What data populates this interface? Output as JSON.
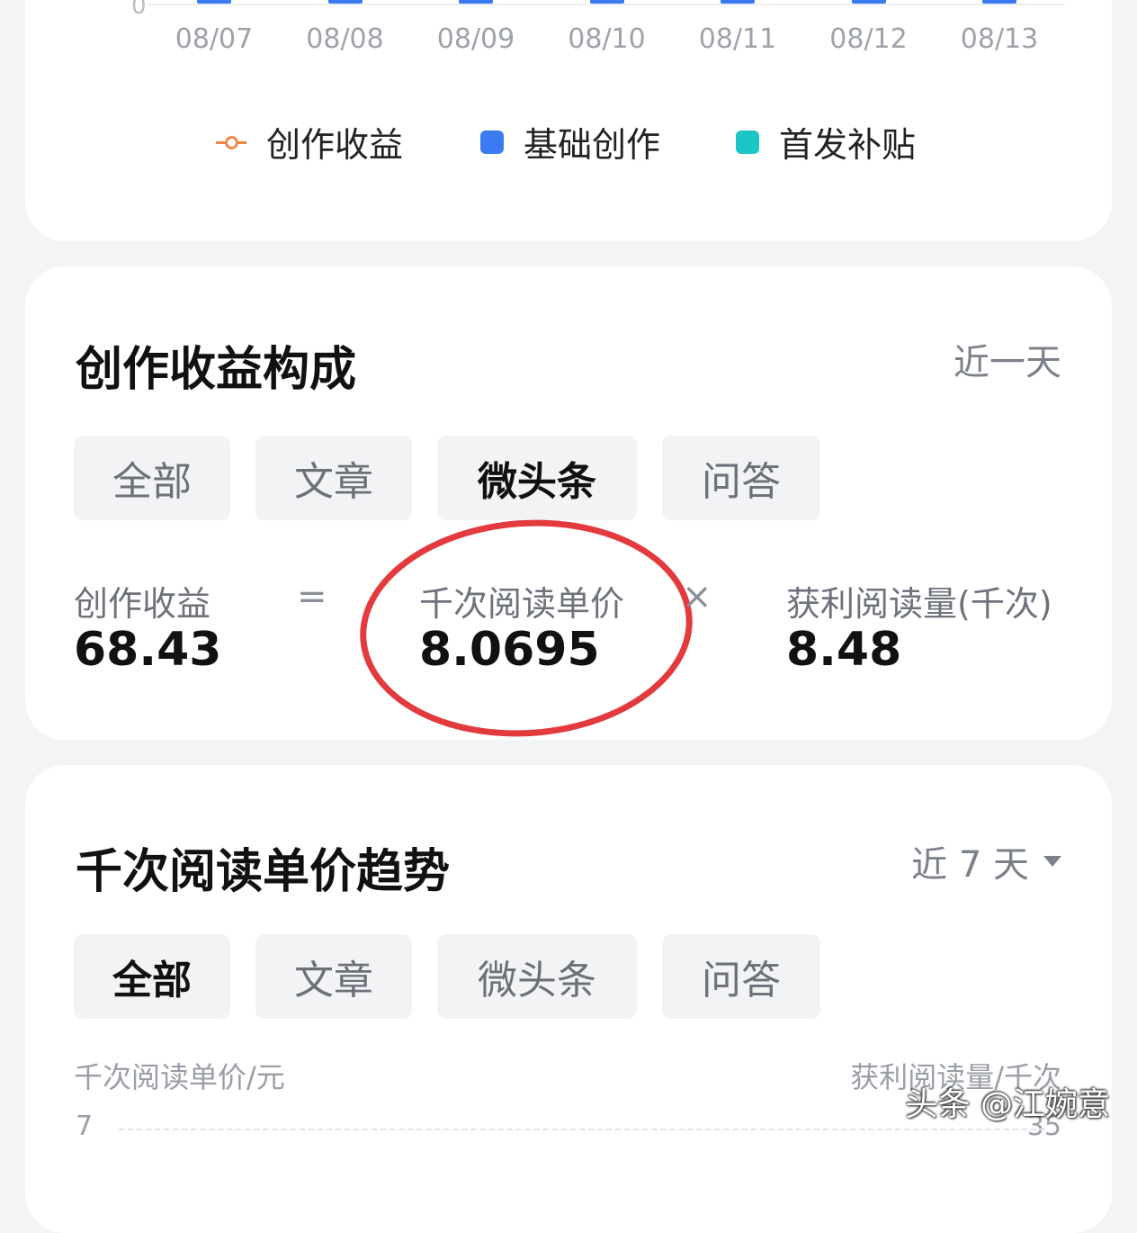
{
  "top_chart": {
    "axis_zero": "0",
    "dates": [
      "08/07",
      "08/08",
      "08/09",
      "08/10",
      "08/11",
      "08/12",
      "08/13"
    ],
    "legend": [
      {
        "label": "创作收益",
        "color": "#f0884a",
        "symbol": "line-dot"
      },
      {
        "label": "基础创作",
        "color": "#3a7bf2",
        "symbol": "square"
      },
      {
        "label": "首发补贴",
        "color": "#1cc6c4",
        "symbol": "square"
      }
    ]
  },
  "breakdown": {
    "title": "创作收益构成",
    "range": "近一天",
    "tabs": [
      "全部",
      "文章",
      "微头条",
      "问答"
    ],
    "active_tab": "微头条",
    "formula": {
      "income_label": "创作收益",
      "income_value": "68.43",
      "equals": "=",
      "price_label": "千次阅读单价",
      "price_value": "8.0695",
      "times": "×",
      "reads_label": "获利阅读量(千次)",
      "reads_value": "8.48"
    }
  },
  "trend": {
    "title": "千次阅读单价趋势",
    "range": "近 7 天",
    "tabs": [
      "全部",
      "文章",
      "微头条",
      "问答"
    ],
    "active_tab": "全部",
    "left_axis_title": "千次阅读单价/元",
    "right_axis_title": "获利阅读量/千次",
    "left_axis_top": "7",
    "right_axis_top": "35"
  },
  "watermark": "头条 @江婉意",
  "colors": {
    "accent_blue": "#3a7bf2",
    "highlight_red": "#e23a3d"
  }
}
